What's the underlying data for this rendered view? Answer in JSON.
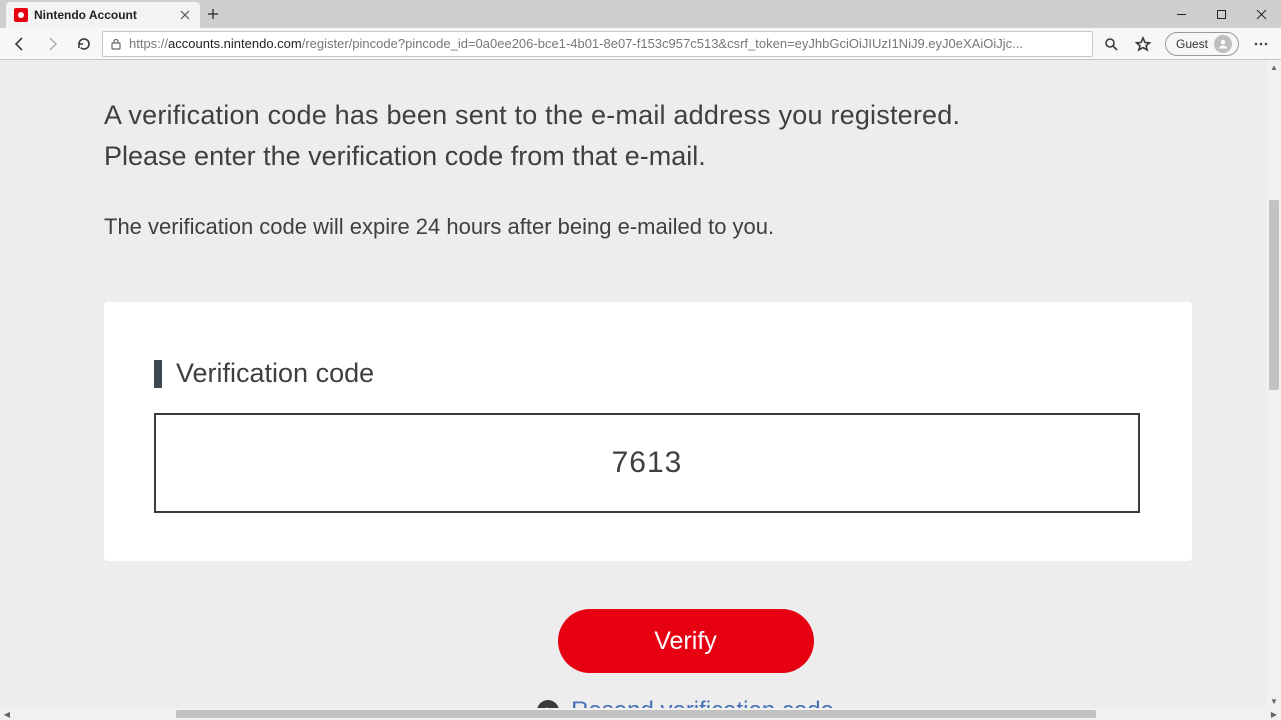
{
  "browser": {
    "tab_title": "Nintendo Account",
    "url_scheme": "https://",
    "url_host": "accounts.nintendo.com",
    "url_path": "/register/pincode?pincode_id=0a0ee206-bce1-4b01-8e07-f153c957c513&csrf_token=eyJhbGciOiJIUzI1NiJ9.eyJ0eXAiOiJjc...",
    "guest_label": "Guest"
  },
  "page": {
    "intro_line_1": "A verification code has been sent to the e-mail address you registered.",
    "intro_line_2": "Please enter the verification code from that e-mail.",
    "expire_note": "The verification code will expire 24 hours after being e-mailed to you.",
    "section_title": "Verification code",
    "code_value": "7613",
    "verify_label": "Verify",
    "resend_label": "Resend verification code"
  }
}
